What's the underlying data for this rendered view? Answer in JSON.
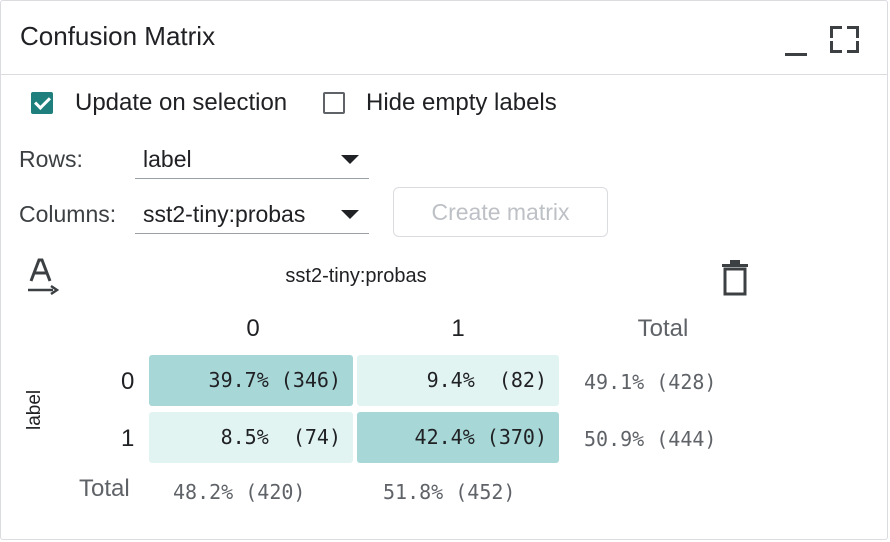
{
  "panel": {
    "title": "Confusion Matrix"
  },
  "options": {
    "update_on_selection": {
      "label": "Update on selection",
      "checked": true
    },
    "hide_empty_labels": {
      "label": "Hide empty labels",
      "checked": false
    }
  },
  "rows": {
    "label": "Rows:",
    "value": "label"
  },
  "columns": {
    "label": "Columns:",
    "value": "sst2-tiny:probas"
  },
  "create_button": {
    "label": "Create matrix"
  },
  "icons": {
    "font": "font-format-icon",
    "delete": "trash-icon"
  },
  "matrix": {
    "column_field": "sst2-tiny:probas",
    "row_field": "label",
    "column_headers": [
      "0",
      "1",
      "Total"
    ],
    "row_headers": [
      "0",
      "1",
      "Total"
    ],
    "cells": [
      [
        "39.7% (346)",
        " 9.4%  (82)",
        "49.1% (428)"
      ],
      [
        " 8.5%  (74)",
        "42.4% (370)",
        "50.9% (444)"
      ]
    ],
    "column_totals": [
      "48.2% (420)",
      "51.8% (452)"
    ],
    "colors": {
      "diagonal": "#a7d7d7",
      "off_diagonal": "#e1f4f2",
      "accent": "#1e7f7c"
    }
  }
}
